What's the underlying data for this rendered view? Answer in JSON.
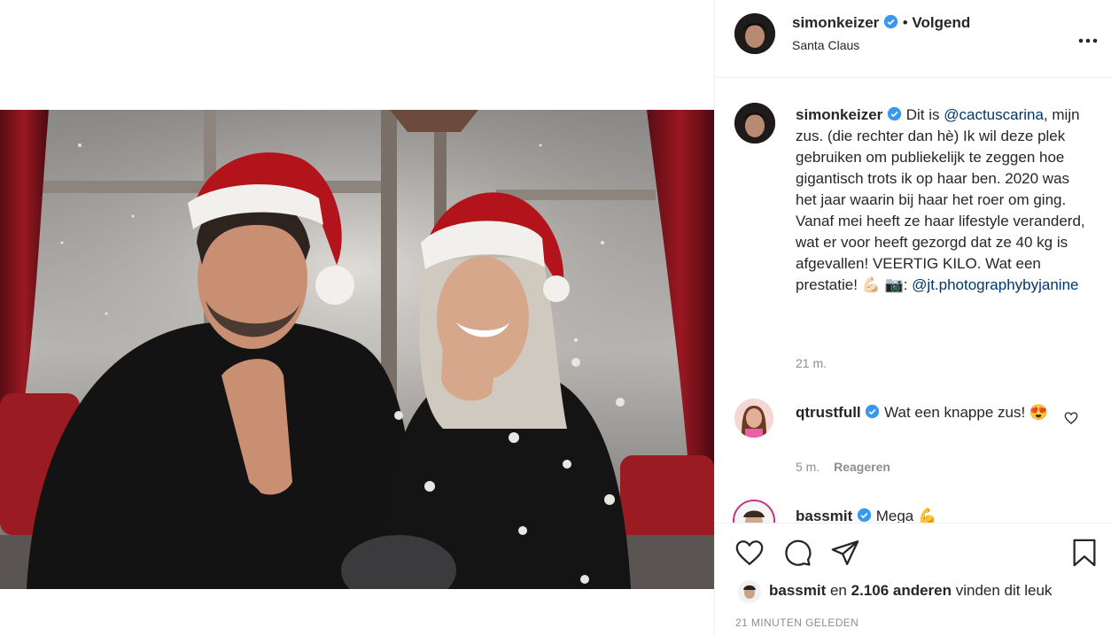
{
  "post": {
    "username": "simonkeizer",
    "follow_state": "Volgend",
    "separator": "•",
    "location": "Santa Claus",
    "more_icon": "more-options-icon"
  },
  "caption": {
    "username": "simonkeizer",
    "text_1": " Dit is ",
    "mention_1": "@cactuscarina",
    "text_2": ", mijn zus. (die rechter dan hè) Ik wil deze plek gebruiken om publiekelijk te zeggen hoe gigantisch trots ik op haar ben. 2020 was het jaar waarin bij haar het roer om ging. Vanaf mei heeft ze haar lifestyle veranderd, wat er voor heeft gezorgd dat ze 40 kg is afgevallen! VEERTIG KILO. Wat een prestatie! 💪🏻 📷: ",
    "mention_2": "@jt.photographybyjanine",
    "time": "21 m."
  },
  "comments": [
    {
      "username": "qtrustfull",
      "text": " Wat een knappe zus! 😍",
      "time": "5 m.",
      "reply": "Reageren"
    },
    {
      "username": "bassmit",
      "text": " Mega 💪"
    }
  ],
  "likes": {
    "user": "bassmit",
    "middle": " en ",
    "count": "2.106 anderen",
    "suffix": " vinden dit leuk",
    "timestamp": "21 MINUTEN GELEDEN"
  },
  "colors": {
    "verified": "#3897f0",
    "mention": "#00376b",
    "muted": "#8e8e8e",
    "border": "#efefef"
  }
}
